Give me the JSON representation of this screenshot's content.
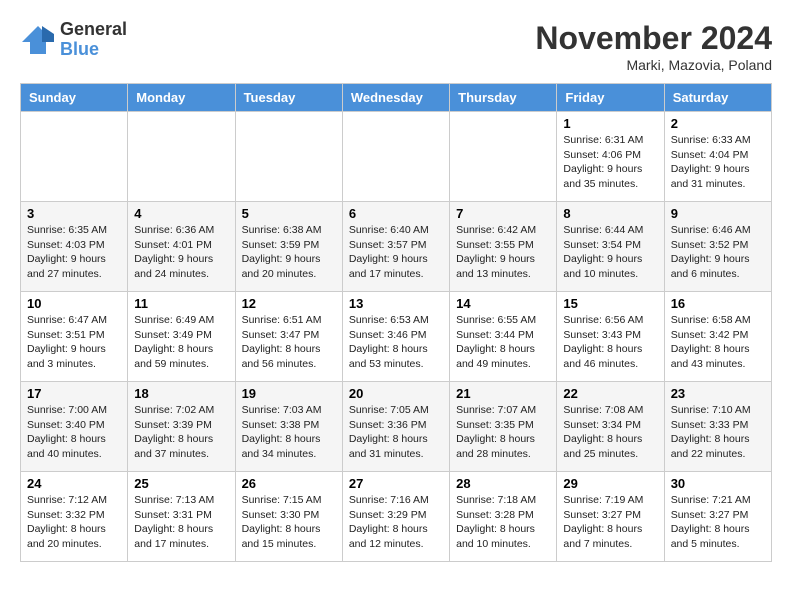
{
  "header": {
    "logo_general": "General",
    "logo_blue": "Blue",
    "month_title": "November 2024",
    "location": "Marki, Mazovia, Poland"
  },
  "days_of_week": [
    "Sunday",
    "Monday",
    "Tuesday",
    "Wednesday",
    "Thursday",
    "Friday",
    "Saturday"
  ],
  "weeks": [
    [
      {
        "day": "",
        "info": ""
      },
      {
        "day": "",
        "info": ""
      },
      {
        "day": "",
        "info": ""
      },
      {
        "day": "",
        "info": ""
      },
      {
        "day": "",
        "info": ""
      },
      {
        "day": "1",
        "info": "Sunrise: 6:31 AM\nSunset: 4:06 PM\nDaylight: 9 hours and 35 minutes."
      },
      {
        "day": "2",
        "info": "Sunrise: 6:33 AM\nSunset: 4:04 PM\nDaylight: 9 hours and 31 minutes."
      }
    ],
    [
      {
        "day": "3",
        "info": "Sunrise: 6:35 AM\nSunset: 4:03 PM\nDaylight: 9 hours and 27 minutes."
      },
      {
        "day": "4",
        "info": "Sunrise: 6:36 AM\nSunset: 4:01 PM\nDaylight: 9 hours and 24 minutes."
      },
      {
        "day": "5",
        "info": "Sunrise: 6:38 AM\nSunset: 3:59 PM\nDaylight: 9 hours and 20 minutes."
      },
      {
        "day": "6",
        "info": "Sunrise: 6:40 AM\nSunset: 3:57 PM\nDaylight: 9 hours and 17 minutes."
      },
      {
        "day": "7",
        "info": "Sunrise: 6:42 AM\nSunset: 3:55 PM\nDaylight: 9 hours and 13 minutes."
      },
      {
        "day": "8",
        "info": "Sunrise: 6:44 AM\nSunset: 3:54 PM\nDaylight: 9 hours and 10 minutes."
      },
      {
        "day": "9",
        "info": "Sunrise: 6:46 AM\nSunset: 3:52 PM\nDaylight: 9 hours and 6 minutes."
      }
    ],
    [
      {
        "day": "10",
        "info": "Sunrise: 6:47 AM\nSunset: 3:51 PM\nDaylight: 9 hours and 3 minutes."
      },
      {
        "day": "11",
        "info": "Sunrise: 6:49 AM\nSunset: 3:49 PM\nDaylight: 8 hours and 59 minutes."
      },
      {
        "day": "12",
        "info": "Sunrise: 6:51 AM\nSunset: 3:47 PM\nDaylight: 8 hours and 56 minutes."
      },
      {
        "day": "13",
        "info": "Sunrise: 6:53 AM\nSunset: 3:46 PM\nDaylight: 8 hours and 53 minutes."
      },
      {
        "day": "14",
        "info": "Sunrise: 6:55 AM\nSunset: 3:44 PM\nDaylight: 8 hours and 49 minutes."
      },
      {
        "day": "15",
        "info": "Sunrise: 6:56 AM\nSunset: 3:43 PM\nDaylight: 8 hours and 46 minutes."
      },
      {
        "day": "16",
        "info": "Sunrise: 6:58 AM\nSunset: 3:42 PM\nDaylight: 8 hours and 43 minutes."
      }
    ],
    [
      {
        "day": "17",
        "info": "Sunrise: 7:00 AM\nSunset: 3:40 PM\nDaylight: 8 hours and 40 minutes."
      },
      {
        "day": "18",
        "info": "Sunrise: 7:02 AM\nSunset: 3:39 PM\nDaylight: 8 hours and 37 minutes."
      },
      {
        "day": "19",
        "info": "Sunrise: 7:03 AM\nSunset: 3:38 PM\nDaylight: 8 hours and 34 minutes."
      },
      {
        "day": "20",
        "info": "Sunrise: 7:05 AM\nSunset: 3:36 PM\nDaylight: 8 hours and 31 minutes."
      },
      {
        "day": "21",
        "info": "Sunrise: 7:07 AM\nSunset: 3:35 PM\nDaylight: 8 hours and 28 minutes."
      },
      {
        "day": "22",
        "info": "Sunrise: 7:08 AM\nSunset: 3:34 PM\nDaylight: 8 hours and 25 minutes."
      },
      {
        "day": "23",
        "info": "Sunrise: 7:10 AM\nSunset: 3:33 PM\nDaylight: 8 hours and 22 minutes."
      }
    ],
    [
      {
        "day": "24",
        "info": "Sunrise: 7:12 AM\nSunset: 3:32 PM\nDaylight: 8 hours and 20 minutes."
      },
      {
        "day": "25",
        "info": "Sunrise: 7:13 AM\nSunset: 3:31 PM\nDaylight: 8 hours and 17 minutes."
      },
      {
        "day": "26",
        "info": "Sunrise: 7:15 AM\nSunset: 3:30 PM\nDaylight: 8 hours and 15 minutes."
      },
      {
        "day": "27",
        "info": "Sunrise: 7:16 AM\nSunset: 3:29 PM\nDaylight: 8 hours and 12 minutes."
      },
      {
        "day": "28",
        "info": "Sunrise: 7:18 AM\nSunset: 3:28 PM\nDaylight: 8 hours and 10 minutes."
      },
      {
        "day": "29",
        "info": "Sunrise: 7:19 AM\nSunset: 3:27 PM\nDaylight: 8 hours and 7 minutes."
      },
      {
        "day": "30",
        "info": "Sunrise: 7:21 AM\nSunset: 3:27 PM\nDaylight: 8 hours and 5 minutes."
      }
    ]
  ]
}
